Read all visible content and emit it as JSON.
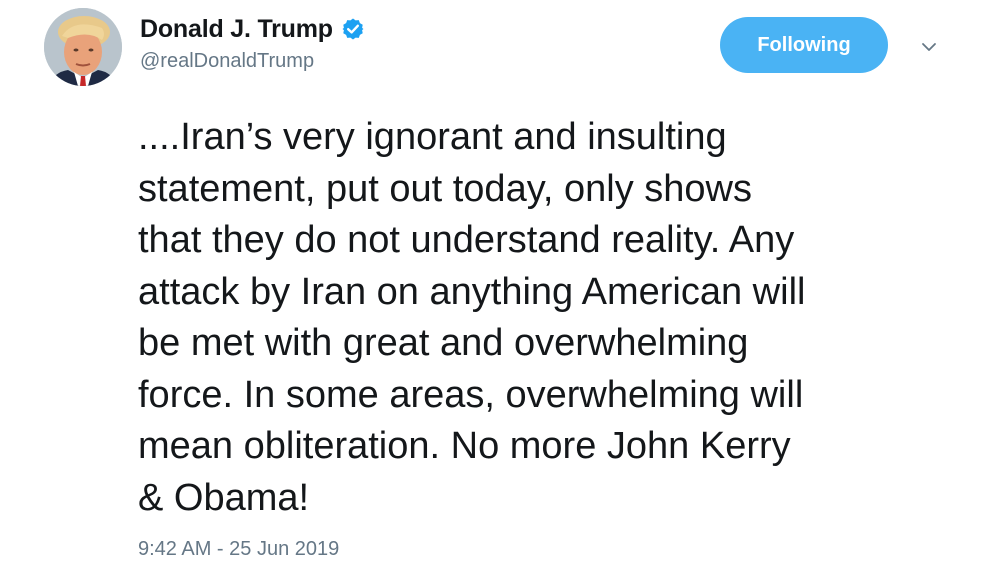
{
  "author": {
    "display_name": "Donald J. Trump",
    "handle": "@realDonaldTrump",
    "verified": true,
    "avatar_icon": "profile-photo"
  },
  "actions": {
    "follow_label": "Following",
    "menu_icon": "chevron-down-icon"
  },
  "tweet": {
    "text_lines": [
      "....Iran’s very ignorant and insulting",
      "statement, put out today, only shows",
      "that they do not understand reality. Any",
      "attack by Iran on anything American will",
      "be met with great and overwhelming",
      "force. In some areas, overwhelming will",
      "mean obliteration. No more John Kerry",
      "& Obama!"
    ],
    "timestamp": "9:42 AM - 25 Jun 2019"
  },
  "colors": {
    "accent": "#4ab3f4",
    "verified": "#1da1f2",
    "secondary_text": "#657786",
    "primary_text": "#14171a"
  }
}
